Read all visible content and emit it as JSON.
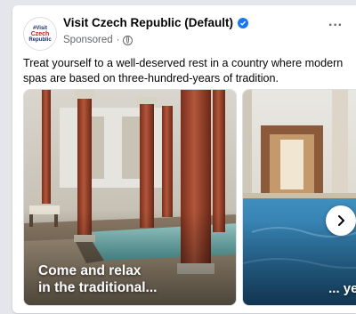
{
  "post": {
    "page_name": "Visit Czech Republic (Default)",
    "sponsored_label": "Sponsored",
    "separator": "·",
    "more_label": "···",
    "body_text": "Treat yourself to a well-deserved rest in a country where modern spas are based on three-hundred-years of tradition.",
    "avatar": {
      "line1": "#Visit",
      "line2": "Czech",
      "line3": "Republic"
    }
  },
  "carousel": {
    "cards": [
      {
        "caption_line1": "Come and relax",
        "caption_line2": "in the traditional..."
      },
      {
        "caption": "... yet m"
      }
    ],
    "next_icon": "chevron-right-icon"
  },
  "colors": {
    "verified": "#1877f2",
    "text": "#050505",
    "muted": "#65676b"
  }
}
